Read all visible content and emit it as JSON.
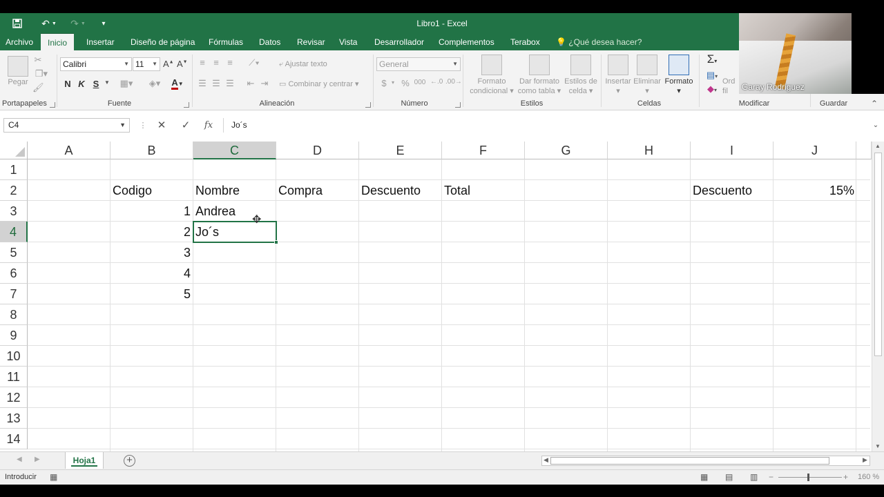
{
  "window": {
    "title": "Libro1 - Excel"
  },
  "tabs": [
    {
      "label": "Archivo"
    },
    {
      "label": "Inicio"
    },
    {
      "label": "Insertar"
    },
    {
      "label": "Diseño de página"
    },
    {
      "label": "Fórmulas"
    },
    {
      "label": "Datos"
    },
    {
      "label": "Revisar"
    },
    {
      "label": "Vista"
    },
    {
      "label": "Desarrollador"
    },
    {
      "label": "Complementos"
    },
    {
      "label": "Terabox"
    }
  ],
  "search": {
    "label": "¿Qué desea hacer?"
  },
  "ribbon": {
    "clipboard": {
      "paste": "Pegar",
      "group": "Portapapeles"
    },
    "font": {
      "name": "Calibri",
      "size": "11",
      "bold": "N",
      "italic": "K",
      "underline": "S",
      "group": "Fuente"
    },
    "alignment": {
      "wrap": "Ajustar texto",
      "merge": "Combinar y centrar",
      "group": "Alineación"
    },
    "number": {
      "format": "General",
      "currency": "$",
      "percent": "%",
      "thousands": "000",
      "group": "Número"
    },
    "styles": {
      "conditional": "Formato",
      "conditional2": "condicional",
      "table": "Dar formato",
      "table2": "como tabla",
      "cell": "Estilos de",
      "cell2": "celda",
      "group": "Estilos"
    },
    "cells": {
      "insert": "Insertar",
      "delete": "Eliminar",
      "format": "Formato",
      "group": "Celdas"
    },
    "editing": {
      "sort": "Ord",
      "sort2": "fil",
      "group": "Modificar"
    },
    "save": {
      "group": "Guardar"
    }
  },
  "formula_bar": {
    "name_box": "C4",
    "content": "Jo´s"
  },
  "columns": [
    "A",
    "B",
    "C",
    "D",
    "E",
    "F",
    "G",
    "H",
    "I",
    "J"
  ],
  "rows": [
    "1",
    "2",
    "3",
    "4",
    "5",
    "6",
    "7",
    "8",
    "9",
    "10",
    "11",
    "12",
    "13",
    "14"
  ],
  "cells": {
    "B2": "Codigo",
    "C2": "Nombre",
    "D2": "Compra",
    "E2": "Descuento",
    "F2": "Total",
    "I2": "Descuento",
    "J2": "15%",
    "B3": "1",
    "C3": "Andrea",
    "B4": "2",
    "C4": "Jo´s",
    "B5": "3",
    "B6": "4",
    "B7": "5"
  },
  "sheets": [
    {
      "name": "Hoja1"
    }
  ],
  "status": {
    "mode": "Introducir",
    "zoom": "160 %"
  },
  "webcam": {
    "name": "Garay Rodriguez"
  },
  "colors": {
    "excel_green": "#217346",
    "ribbon_bg": "#f3f3f3",
    "header_selected": "#d2d2d2"
  }
}
